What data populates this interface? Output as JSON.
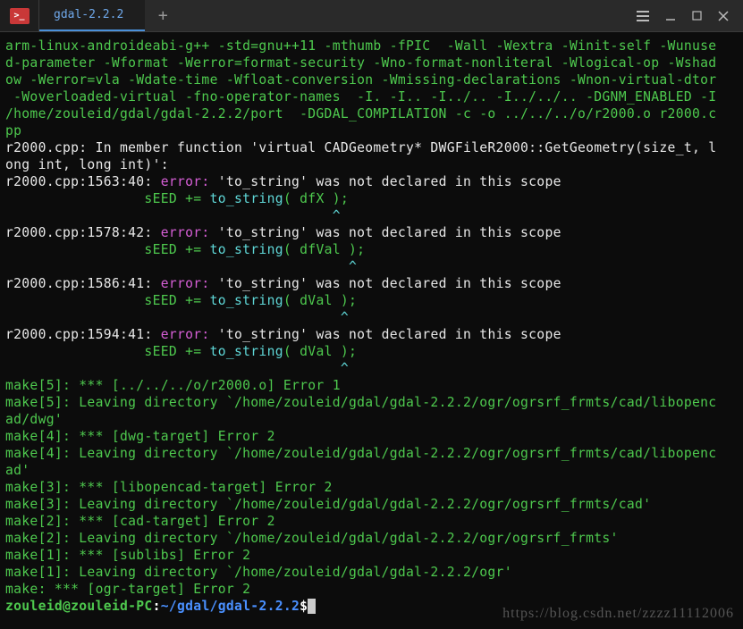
{
  "titlebar": {
    "app_icon_text": ">_",
    "tab_title": "gdal-2.2.2",
    "new_tab": "+"
  },
  "terminal": {
    "compile_cmd": "arm-linux-androideabi-g++ -std=gnu++11 -mthumb -fPIC  -Wall -Wextra -Winit-self -Wunused-parameter -Wformat -Werror=format-security -Wno-format-nonliteral -Wlogical-op -Wshadow -Werror=vla -Wdate-time -Wfloat-conversion -Wmissing-declarations -Wnon-virtual-dtor -Woverloaded-virtual -fno-operator-names  -I. -I.. -I../.. -I../../.. -DGNM_ENABLED -I/home/zouleid/gdal/gdal-2.2.2/port  -DGDAL_COMPILATION -c -o ../../../o/r2000.o r2000.cpp",
    "member_fn_msg_pre": "r2000.cpp: In member function '",
    "member_fn_sig": "virtual CADGeometry* DWGFileR2000::GetGeometry(size_t, long int, long int)",
    "member_fn_msg_post": "':",
    "errors": [
      {
        "loc": "r2000.cpp:1563:40: ",
        "err_kw": "error: ",
        "msg_pre": "'",
        "sym": "to_string",
        "msg_post": "' was not declared in this scope",
        "code_indent": "                 ",
        "code_pre": "sEED += ",
        "code_fn": "to_string",
        "code_args": "( dfX );",
        "caret_line": "                                        ",
        "caret": "^"
      },
      {
        "loc": "r2000.cpp:1578:42: ",
        "err_kw": "error: ",
        "msg_pre": "'",
        "sym": "to_string",
        "msg_post": "' was not declared in this scope",
        "code_indent": "                 ",
        "code_pre": "sEED += ",
        "code_fn": "to_string",
        "code_args": "( dfVal );",
        "caret_line": "                                          ",
        "caret": "^"
      },
      {
        "loc": "r2000.cpp:1586:41: ",
        "err_kw": "error: ",
        "msg_pre": "'",
        "sym": "to_string",
        "msg_post": "' was not declared in this scope",
        "code_indent": "                 ",
        "code_pre": "sEED += ",
        "code_fn": "to_string",
        "code_args": "( dVal );",
        "caret_line": "                                         ",
        "caret": "^"
      },
      {
        "loc": "r2000.cpp:1594:41: ",
        "err_kw": "error: ",
        "msg_pre": "'",
        "sym": "to_string",
        "msg_post": "' was not declared in this scope",
        "code_indent": "                 ",
        "code_pre": "sEED += ",
        "code_fn": "to_string",
        "code_args": "( dVal );",
        "caret_line": "                                         ",
        "caret": "^"
      }
    ],
    "make_lines": [
      "make[5]: *** [../../../o/r2000.o] Error 1",
      "make[5]: Leaving directory `/home/zouleid/gdal/gdal-2.2.2/ogr/ogrsrf_frmts/cad/libopencad/dwg'",
      "make[4]: *** [dwg-target] Error 2",
      "make[4]: Leaving directory `/home/zouleid/gdal/gdal-2.2.2/ogr/ogrsrf_frmts/cad/libopencad'",
      "make[3]: *** [libopencad-target] Error 2",
      "make[3]: Leaving directory `/home/zouleid/gdal/gdal-2.2.2/ogr/ogrsrf_frmts/cad'",
      "make[2]: *** [cad-target] Error 2",
      "make[2]: Leaving directory `/home/zouleid/gdal/gdal-2.2.2/ogr/ogrsrf_frmts'",
      "make[1]: *** [sublibs] Error 2",
      "make[1]: Leaving directory `/home/zouleid/gdal/gdal-2.2.2/ogr'",
      "make: *** [ogr-target] Error 2"
    ],
    "prompt": {
      "user_host": "zouleid@zouleid-PC",
      "colon": ":",
      "path": "~/gdal/gdal-2.2.2",
      "dollar": "$"
    }
  },
  "watermark": "https://blog.csdn.net/zzzz11112006"
}
